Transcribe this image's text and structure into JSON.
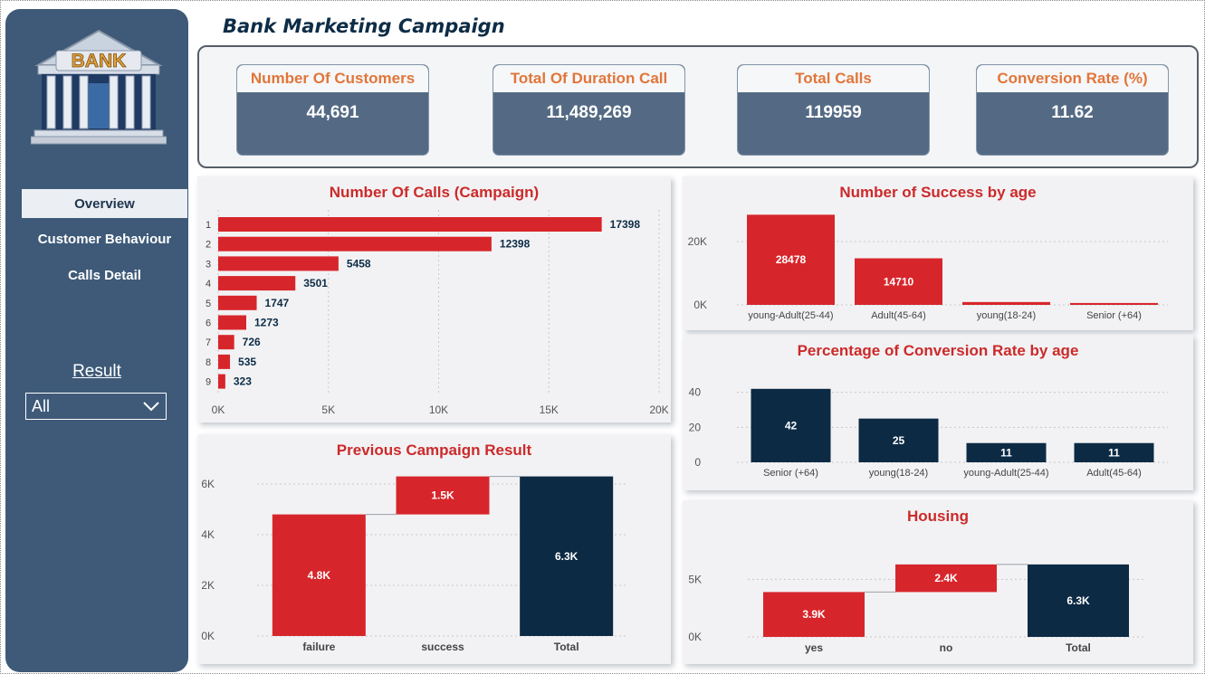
{
  "app": {
    "title": "Bank Marketing Campaign",
    "logo_text": "BANK"
  },
  "sidebar": {
    "items": [
      {
        "label": "Overview",
        "active": true
      },
      {
        "label": "Customer Behaviour",
        "active": false
      },
      {
        "label": "Calls Detail",
        "active": false
      }
    ],
    "filter": {
      "label": "Result",
      "selected": "All"
    }
  },
  "kpis": [
    {
      "label": "Number Of Customers",
      "value": "44,691"
    },
    {
      "label": "Total Of Duration Call",
      "value": "11,489,269"
    },
    {
      "label": "Total Calls",
      "value": "119959"
    },
    {
      "label": "Conversion Rate (%)",
      "value": "11.62"
    }
  ],
  "colors": {
    "sidebar": "#3e5a78",
    "accent_orange": "#e0763a",
    "bar_red": "#d7262b",
    "bar_navy": "#0c2a44",
    "title_red": "#cc2a2a"
  },
  "chart_data": [
    {
      "id": "calls_campaign",
      "type": "bar",
      "orientation": "horizontal",
      "title": "Number Of Calls (Campaign)",
      "categories": [
        "1",
        "2",
        "3",
        "4",
        "5",
        "6",
        "7",
        "8",
        "9"
      ],
      "values": [
        17398,
        12398,
        5458,
        3501,
        1747,
        1273,
        726,
        535,
        323
      ],
      "xlim": [
        0,
        20000
      ],
      "xticks": [
        "0K",
        "5K",
        "10K",
        "15K",
        "20K"
      ],
      "grid": true
    },
    {
      "id": "success_by_age",
      "type": "bar",
      "title": "Number of Success by age",
      "categories": [
        "young-Adult(25-44)",
        "Adult(45-64)",
        "young(18-24)",
        "Senior (+64)"
      ],
      "values": [
        28478,
        14710,
        900,
        600
      ],
      "labels": [
        "28478",
        "14710",
        "",
        ""
      ],
      "ylim": [
        0,
        30000
      ],
      "yticks": [
        "0K",
        "20K"
      ],
      "grid": true
    },
    {
      "id": "conversion_by_age",
      "type": "bar",
      "title": "Percentage of Conversion Rate by age",
      "categories": [
        "Senior (+64)",
        "young(18-24)",
        "young-Adult(25-44)",
        "Adult(45-64)"
      ],
      "values": [
        42,
        25,
        11,
        11
      ],
      "labels": [
        "42",
        "25",
        "11",
        "11"
      ],
      "ylim": [
        0,
        45
      ],
      "yticks": [
        "0",
        "20",
        "40"
      ],
      "grid": true
    },
    {
      "id": "previous_campaign",
      "type": "bar",
      "subtype": "waterfall",
      "title": "Previous Campaign Result",
      "categories": [
        "failure",
        "success",
        "Total"
      ],
      "values": [
        4800,
        1500,
        6300
      ],
      "labels": [
        "4.8K",
        "1.5K",
        "6.3K"
      ],
      "ylim": [
        0,
        7000
      ],
      "yticks": [
        "0K",
        "2K",
        "4K",
        "6K"
      ],
      "grid": true
    },
    {
      "id": "housing",
      "type": "bar",
      "subtype": "waterfall",
      "title": "Housing",
      "categories": [
        "yes",
        "no",
        "Total"
      ],
      "values": [
        3900,
        2400,
        6300
      ],
      "labels": [
        "3.9K",
        "2.4K",
        "6.3K"
      ],
      "ylim": [
        0,
        7000
      ],
      "yticks": [
        "0K",
        "5K"
      ],
      "grid": true
    }
  ]
}
